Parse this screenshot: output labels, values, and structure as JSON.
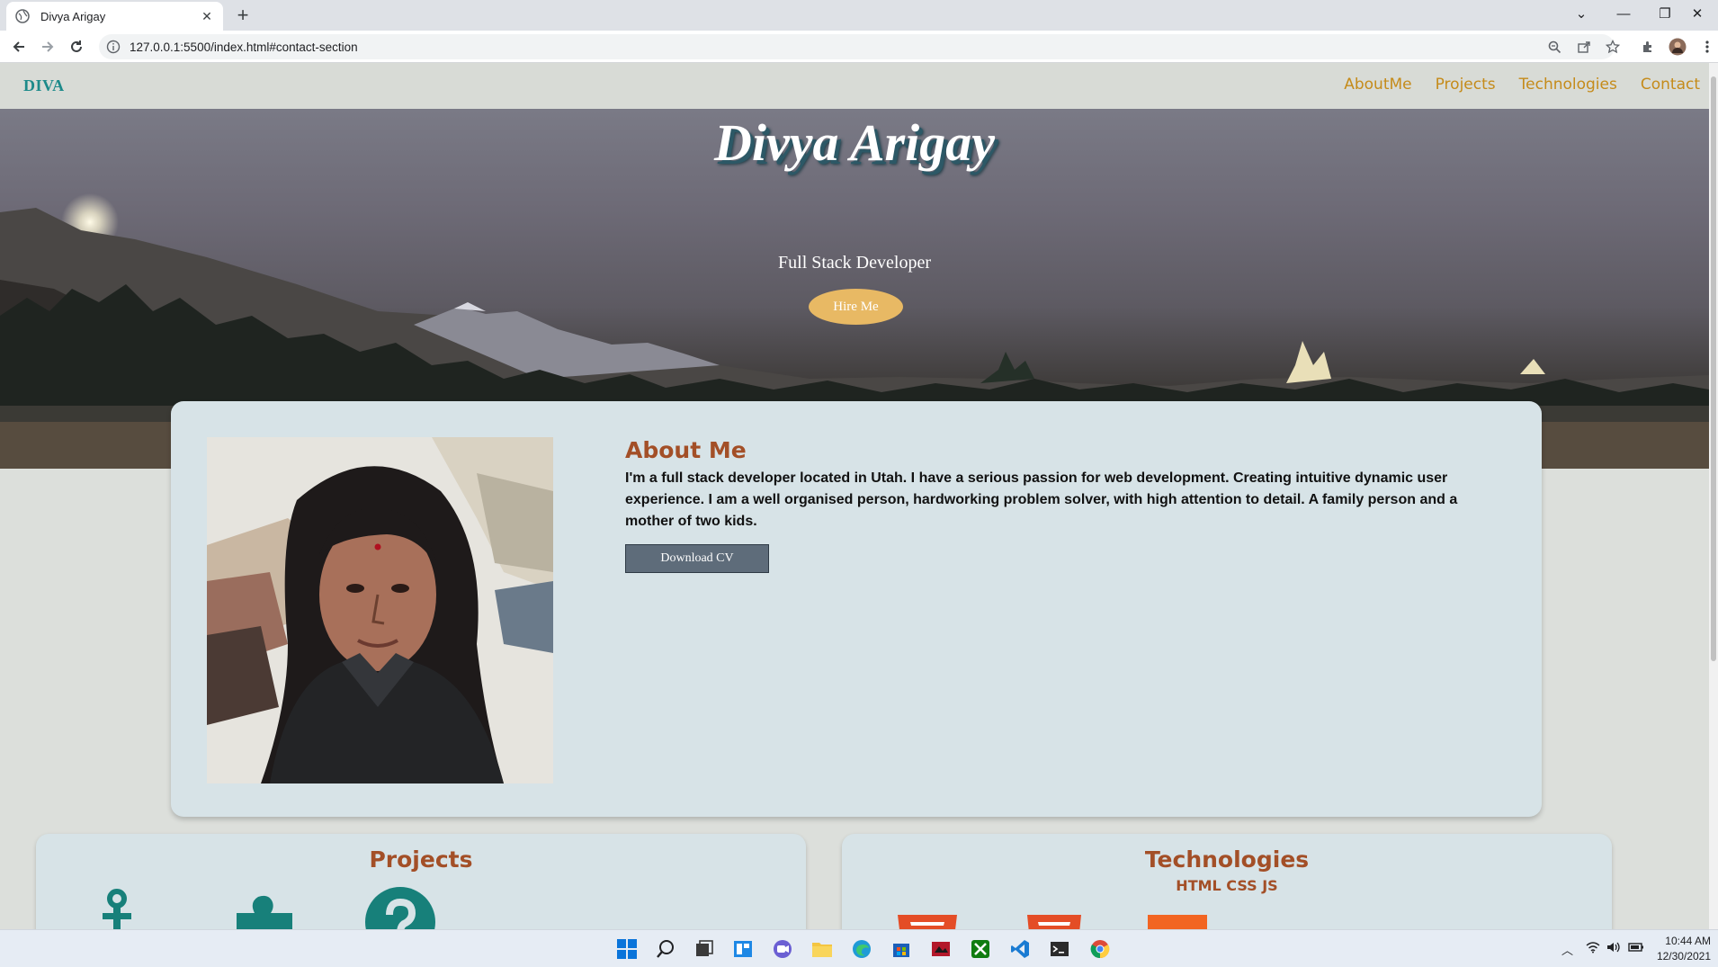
{
  "browser": {
    "tab_title": "Divya Arigay",
    "url": "127.0.0.1:5500/index.html#contact-section"
  },
  "site": {
    "brand": "DIVA",
    "nav": [
      "AboutMe",
      "Projects",
      "Technologies",
      "Contact"
    ]
  },
  "hero": {
    "title": "Divya Arigay",
    "subtitle": "Full Stack Developer",
    "cta": "Hire Me"
  },
  "about": {
    "heading": "About Me",
    "text": "I'm a full stack developer located in Utah. I have a serious passion for web development. Creating intuitive dynamic user experience. I am a well organised person, hardworking problem solver, with high attention to detail. A family person and a mother of two kids.",
    "download_label": "Download CV"
  },
  "projects": {
    "heading": "Projects",
    "icons": [
      "anchor-icon",
      "puzzle-icon",
      "question-icon"
    ]
  },
  "technologies": {
    "heading": "Technologies",
    "subheading": "HTML CSS JS",
    "icons": [
      "html5-icon",
      "css3-icon",
      "js-icon"
    ]
  },
  "taskbar": {
    "time": "10:44 AM",
    "date": "12/30/2021"
  },
  "colors": {
    "accent_brown": "#a34f27",
    "nav_gold": "#c58b1a",
    "brand_teal": "#1d8a8a",
    "hire_button": "#e8b964",
    "card_bg": "#d7e3e7",
    "icon_teal": "#17807a"
  }
}
